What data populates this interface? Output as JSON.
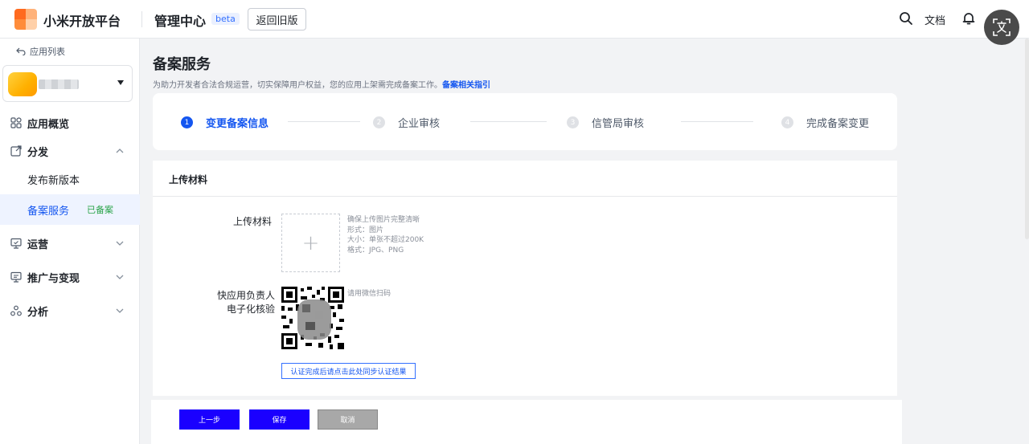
{
  "topbar": {
    "brand": "小米开放平台",
    "section": "管理中心",
    "beta": "beta",
    "old_version": "返回旧版",
    "docs": "文档"
  },
  "sidebar": {
    "back_link": "应用列表",
    "nav": [
      {
        "label": "应用概览",
        "icon": "grid-icon",
        "expandable": false
      },
      {
        "label": "分发",
        "icon": "external-link-icon",
        "expandable": true,
        "expanded": true
      },
      {
        "label": "运营",
        "icon": "monitor-icon",
        "expandable": true,
        "expanded": false
      },
      {
        "label": "推广与变现",
        "icon": "promo-icon",
        "expandable": true,
        "expanded": false
      },
      {
        "label": "分析",
        "icon": "analysis-icon",
        "expandable": true,
        "expanded": false
      }
    ],
    "sub_items": [
      {
        "label": "发布新版本",
        "active": false
      },
      {
        "label": "备案服务",
        "active": true,
        "tag": "已备案"
      }
    ]
  },
  "main": {
    "title": "备案服务",
    "desc": "为助力开发者合法合规运营，切实保障用户权益，您的应用上架需完成备案工作。",
    "desc_link": "备案相关指引",
    "steps": [
      {
        "num": "1",
        "label": "变更备案信息",
        "active": true
      },
      {
        "num": "2",
        "label": "企业审核",
        "active": false
      },
      {
        "num": "3",
        "label": "信管局审核",
        "active": false
      },
      {
        "num": "4",
        "label": "完成备案变更",
        "active": false
      }
    ],
    "form": {
      "section_title": "上传材料",
      "upload_label": "上传材料",
      "upload_plus": "+",
      "upload_hints": [
        "确保上传图片完整清晰",
        "形式：图片",
        "大小：单张不超过200K",
        "格式：JPG、PNG"
      ],
      "verify_label_line1": "快应用负责人",
      "verify_label_line2": "电子化核验",
      "qr_hint": "请用微信扫码",
      "sync_button": "认证完成后请点击此处同步认证结果"
    },
    "footer": {
      "prev": "上一步",
      "save": "保存",
      "cancel": "取消"
    }
  },
  "colors": {
    "primary": "#1456f0",
    "button_primary": "#1a00ff",
    "success": "#2ba44a"
  }
}
